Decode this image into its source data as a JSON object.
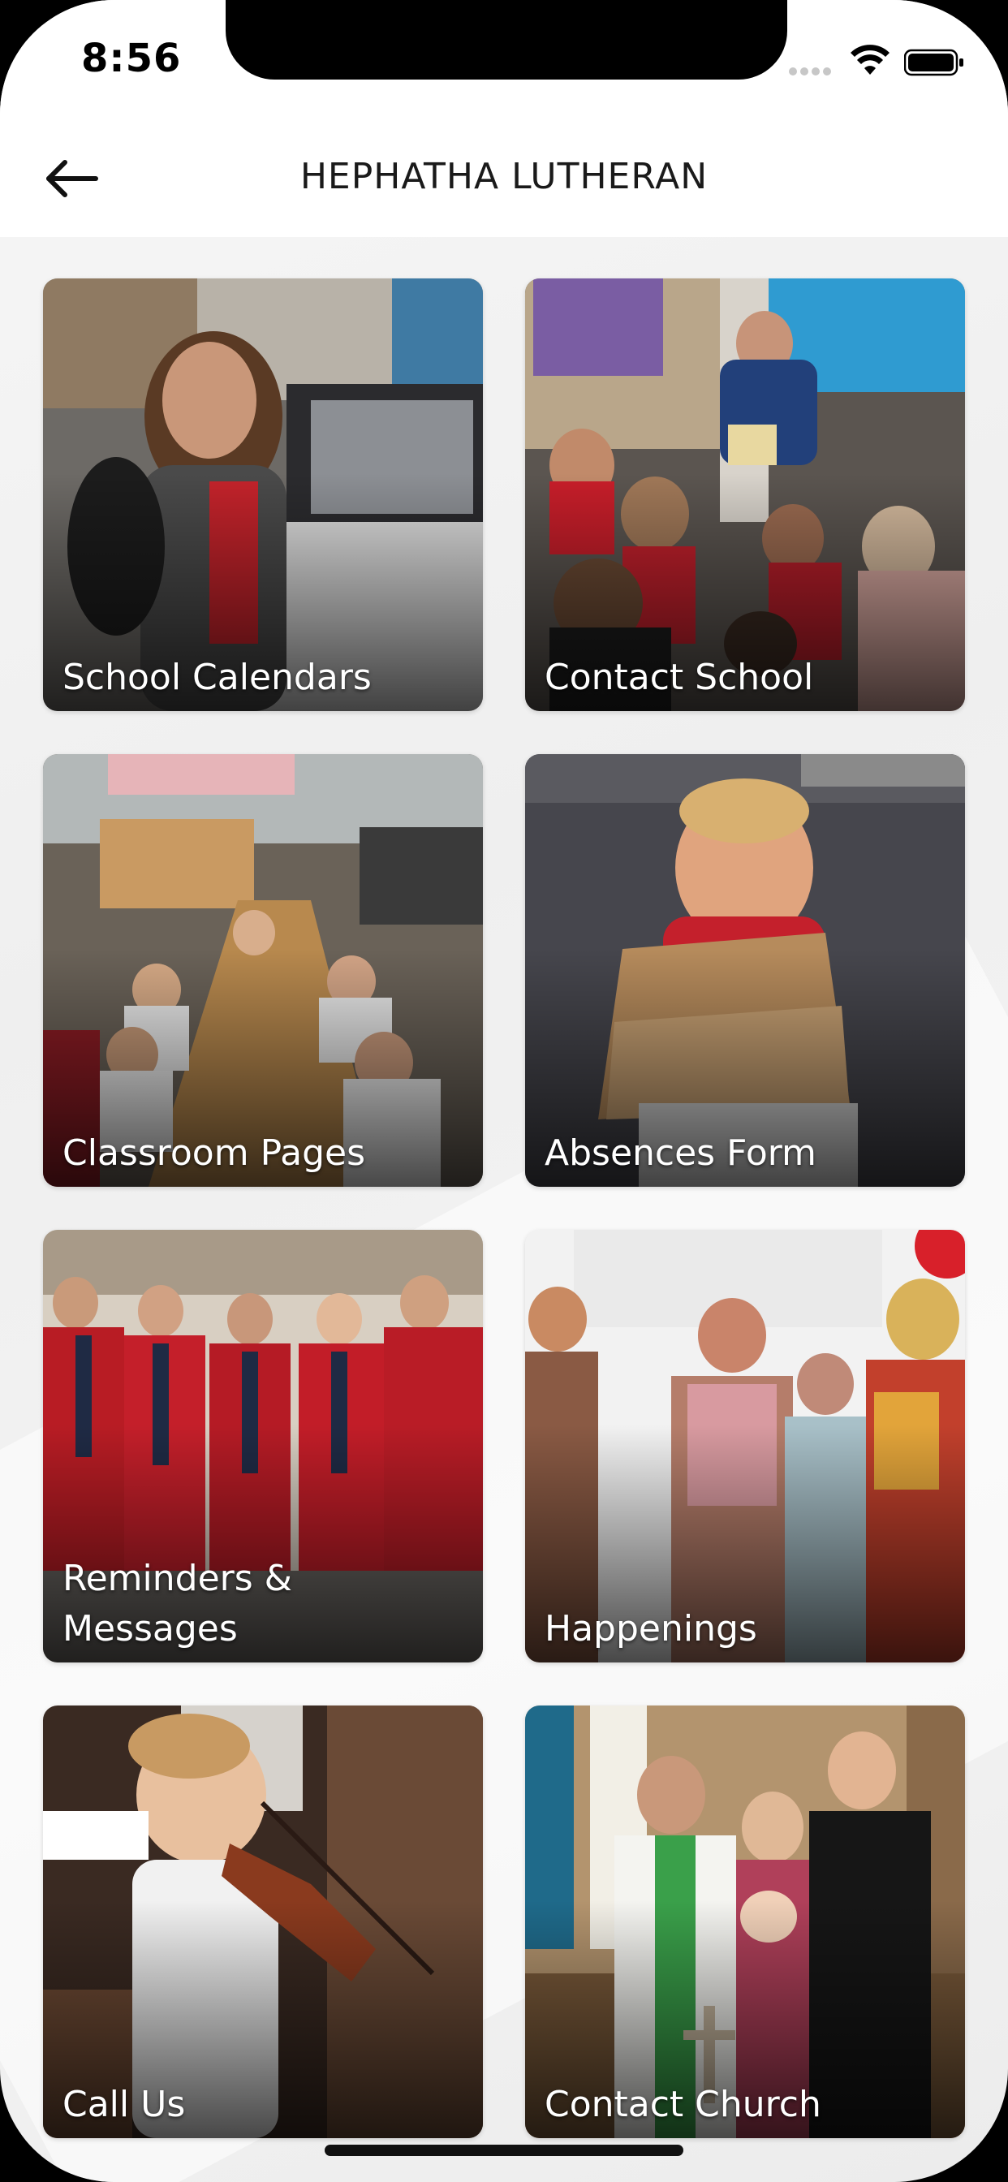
{
  "status_bar": {
    "time": "8:56"
  },
  "header": {
    "title": "HEPHATHA LUTHERAN",
    "back_icon": "arrow-left-icon"
  },
  "tiles": [
    {
      "label": "School Calendars",
      "photo": "girl-at-desk-with-laptop"
    },
    {
      "label": "Contact School",
      "photo": "teacher-reading-to-students"
    },
    {
      "label": "Classroom Pages",
      "photo": "classroom-students-at-tables"
    },
    {
      "label": "Absences Form",
      "photo": "boy-holding-verse-box"
    },
    {
      "label": "Reminders & Messages",
      "photo": "graduates-in-red-gowns"
    },
    {
      "label": "Happenings",
      "photo": "color-run-participants"
    },
    {
      "label": "Call Us",
      "photo": "boy-playing-violin"
    },
    {
      "label": "Contact Church",
      "photo": "family-with-pastor-at-altar"
    }
  ]
}
